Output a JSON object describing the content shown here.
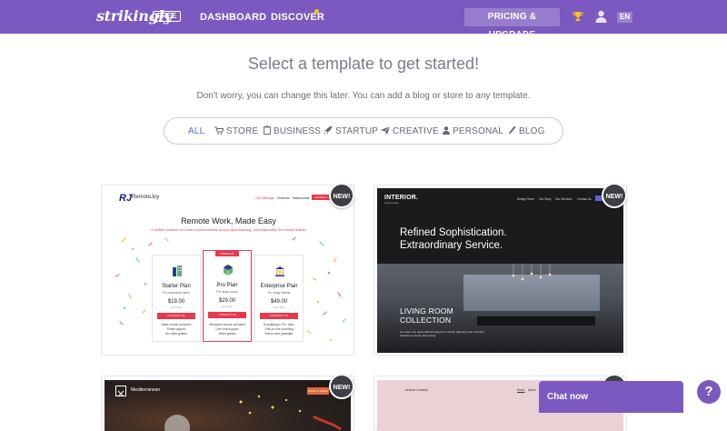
{
  "topbar": {
    "logo": "strikingly",
    "plan_badge": "FREE",
    "nav": {
      "dashboard": "DASHBOARD",
      "discover": "DISCOVER"
    },
    "upgrade_label": "PRICING & UPGRADE",
    "language": "EN",
    "icons": {
      "achievements": "trophy-icon",
      "account": "user-icon"
    },
    "colors": {
      "bar": "#7b59c0",
      "notification_dot": "#f5c518"
    }
  },
  "main": {
    "heading": "Select a template to get started!",
    "subheading": "Don't worry, you can change this later. You can add a blog or store to any template."
  },
  "filters": {
    "active": "ALL",
    "items": [
      {
        "label": "ALL",
        "icon": ""
      },
      {
        "label": "STORE",
        "icon": "cart-icon"
      },
      {
        "label": "BUSINESS",
        "icon": "clipboard-icon"
      },
      {
        "label": "STARTUP",
        "icon": "rocket-icon"
      },
      {
        "label": "CREATIVE",
        "icon": "paper-plane-icon"
      },
      {
        "label": "PERSONAL",
        "icon": "person-icon"
      },
      {
        "label": "BLOG",
        "icon": "pen-icon"
      }
    ],
    "active_color": "#5d66d4"
  },
  "templates": [
    {
      "badge": "NEW!",
      "brand": "RJ",
      "name": "RemoteJoy",
      "menu": [
        "Our Offerings",
        "Features",
        "Testimonials"
      ],
      "cta": "CONTACT",
      "title": "Remote Work, Made Easy",
      "subtitle": "A unified solution for team communication and project tracking, built especially for remote teams!",
      "plans": [
        {
          "name": "Starter Plan",
          "for": "For individual users",
          "price": "$19.00",
          "per": "per month",
          "button": "CONTACT US",
          "features": [
            "Basic course unlocked",
            "Email support",
            "No video guides"
          ]
        },
        {
          "tag": "POPULAR",
          "name": "Pro Plan",
          "for": "For team users",
          "price": "$29.00",
          "per": "per month",
          "button": "CONTACT US",
          "features": [
            "Advanced course unlocked",
            "Live chat support",
            "Video guides"
          ]
        },
        {
          "name": "Enterprise Plan",
          "for": "For large teams",
          "price": "$49.00",
          "per": "per month",
          "button": "CONTACT US",
          "features": [
            "Everything in Pro, plus:",
            "One-on-one coaching",
            "Bonus care package!"
          ]
        }
      ],
      "accent": "#e63950"
    },
    {
      "badge": "NEW!",
      "name": "INTERIOR.",
      "tagline": "Design Studio",
      "menu": [
        "Design Team",
        "Our Story",
        "Our Services",
        "Contact Us"
      ],
      "headline_1": "Refined Sophistication.",
      "headline_2": "Extraordinary Service.",
      "section_1": "LIVING ROOM",
      "section_2": "COLLECTION",
      "section_text": "Our team can assist with all aspects of interior planning, from furniture selection to layout and styling."
    },
    {
      "badge": "NEW!",
      "name": "Mediterranean",
      "cta": "BOOK A TABLE"
    },
    {
      "badge": "NEW!",
      "name": "Andrea Crowley",
      "menu": [
        "Home",
        "About",
        "Gallery",
        "Contact"
      ]
    }
  ],
  "chat": {
    "label": "Chat now",
    "help": "?"
  }
}
